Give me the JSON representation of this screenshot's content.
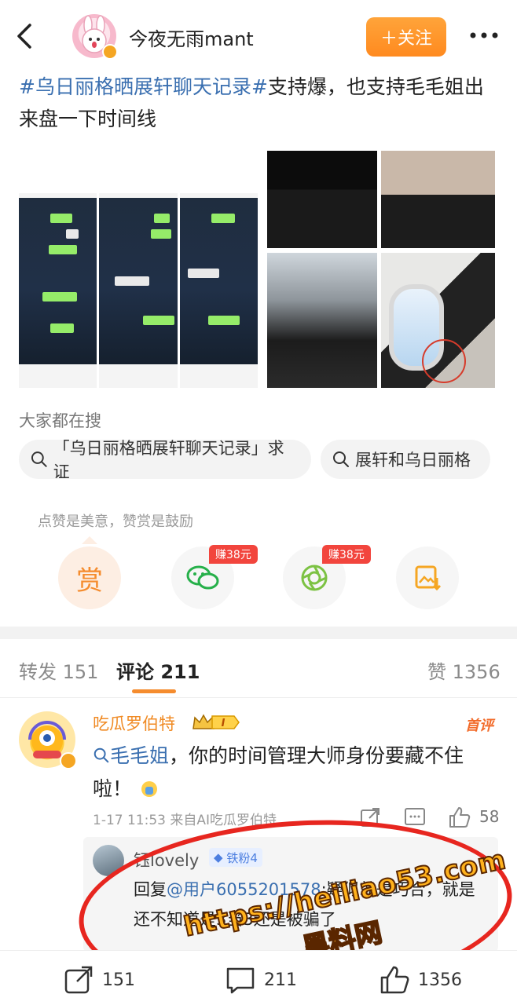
{
  "header": {
    "username": "今夜无雨mant",
    "follow_label": "＋关注"
  },
  "post": {
    "hashtag": "#乌日丽格晒展轩聊天记录#",
    "text": "支持爆，也支持毛毛姐出来盘一下时间线"
  },
  "search": {
    "title": "大家都在搜",
    "chips": [
      "「乌日丽格晒展轩聊天记录」求证",
      "展轩和乌日丽格"
    ]
  },
  "reward": {
    "hint": "点赞是美意，赞赏是鼓励",
    "reward_label": "赏",
    "earn_badge_1": "赚38元",
    "earn_badge_2": "赚38元"
  },
  "tabs": {
    "forward_label": "转发",
    "forward_count": "151",
    "comment_label": "评论",
    "comment_count": "211",
    "like_label": "赞",
    "like_count": "1356"
  },
  "comment": {
    "username": "吃瓜罗伯特",
    "level_badge": "I",
    "first_badge": "首评",
    "mention": "毛毛姐",
    "text": "，你的时间管理大师身份要藏不住啦！",
    "time_source": "1-17 11:53  来自AI吃瓜罗伯特",
    "like_count": "58"
  },
  "reply": {
    "username": "钰lovely",
    "fan_badge": "铁粉4",
    "prefix": "回复",
    "mention": "@用户6055201578",
    "text": ":疑似就是巧合，就是还不知道是3当3还是被骗了"
  },
  "watermark": {
    "url": "https://heiliao53.com",
    "name": "黑料网"
  },
  "bottom_bar": {
    "share_count": "151",
    "comment_count": "211",
    "like_count": "1356"
  },
  "colors": {
    "accent_orange": "#ff8a1f",
    "link_blue": "#3a6fb0",
    "badge_red": "#f2453d",
    "wechat_green": "#26b04a"
  }
}
